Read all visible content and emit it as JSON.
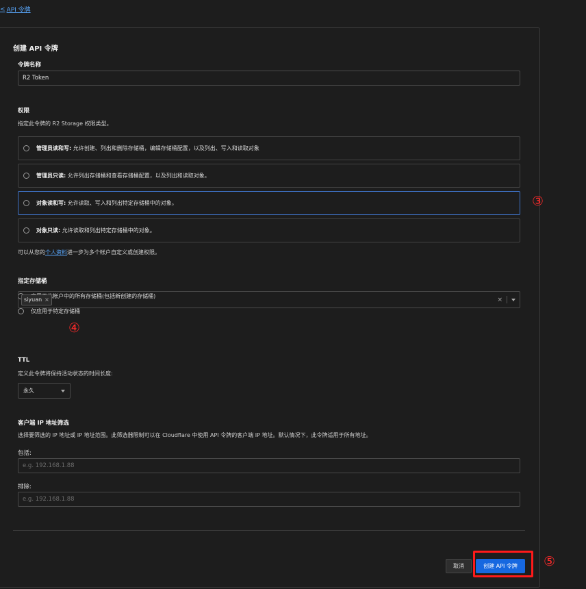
{
  "back_link": "API 令牌",
  "form": {
    "title": "创建 API 令牌",
    "token_name": {
      "label": "令牌名称",
      "value": "R2 Token"
    },
    "permissions": {
      "label": "权限",
      "desc": "指定此令牌的 R2 Storage 权限类型。",
      "options": [
        {
          "title": "管理员读和写:",
          "text": " 允许创建、列出和删除存储桶，编辑存储桶配置，以及列出、写入和读取对象"
        },
        {
          "title": "管理员只读:",
          "text": " 允许列出存储桶和查看存储桶配置，以及列出和读取对象。"
        },
        {
          "title": "对象读和写:",
          "text": " 允许读取、写入和列出特定存储桶中的对象。"
        },
        {
          "title": "对象只读:",
          "text": " 允许读取和列出特定存储桶中的对象。"
        }
      ],
      "note_prefix": "可以从您的",
      "note_link": "个人资料",
      "note_suffix": "进一步为多个帐户自定义或创建权限。"
    },
    "buckets": {
      "label": "指定存储桶",
      "option_all": "应用于此帐户中的所有存储桶(包括新创建的存储桶)",
      "option_specific": "仅应用于特定存储桶",
      "selected_tag": "siyuan"
    },
    "ttl": {
      "label": "TTL",
      "desc": "定义此令牌将保持活动状态的时间长度:",
      "value": "永久"
    },
    "ip_filter": {
      "label": "客户端 IP 地址筛选",
      "desc": "选择要筛选的 IP 地址或 IP 地址范围。此筛选器限制可以在 Cloudflare 中使用 API 令牌的客户端 IP 地址。默认情况下，此令牌适用于所有地址。",
      "include_label": "包括:",
      "include_placeholder": "e.g. 192.168.1.88",
      "exclude_label": "排除:",
      "exclude_placeholder": "e.g. 192.168.1.88"
    },
    "buttons": {
      "cancel": "取消",
      "create": "创建 API 令牌"
    }
  },
  "annotations": {
    "three": "③",
    "four": "④",
    "five": "⑤"
  },
  "colors": {
    "accent": "#1768e0",
    "link": "#5aa9ff",
    "annotation": "#ff2a2a"
  }
}
